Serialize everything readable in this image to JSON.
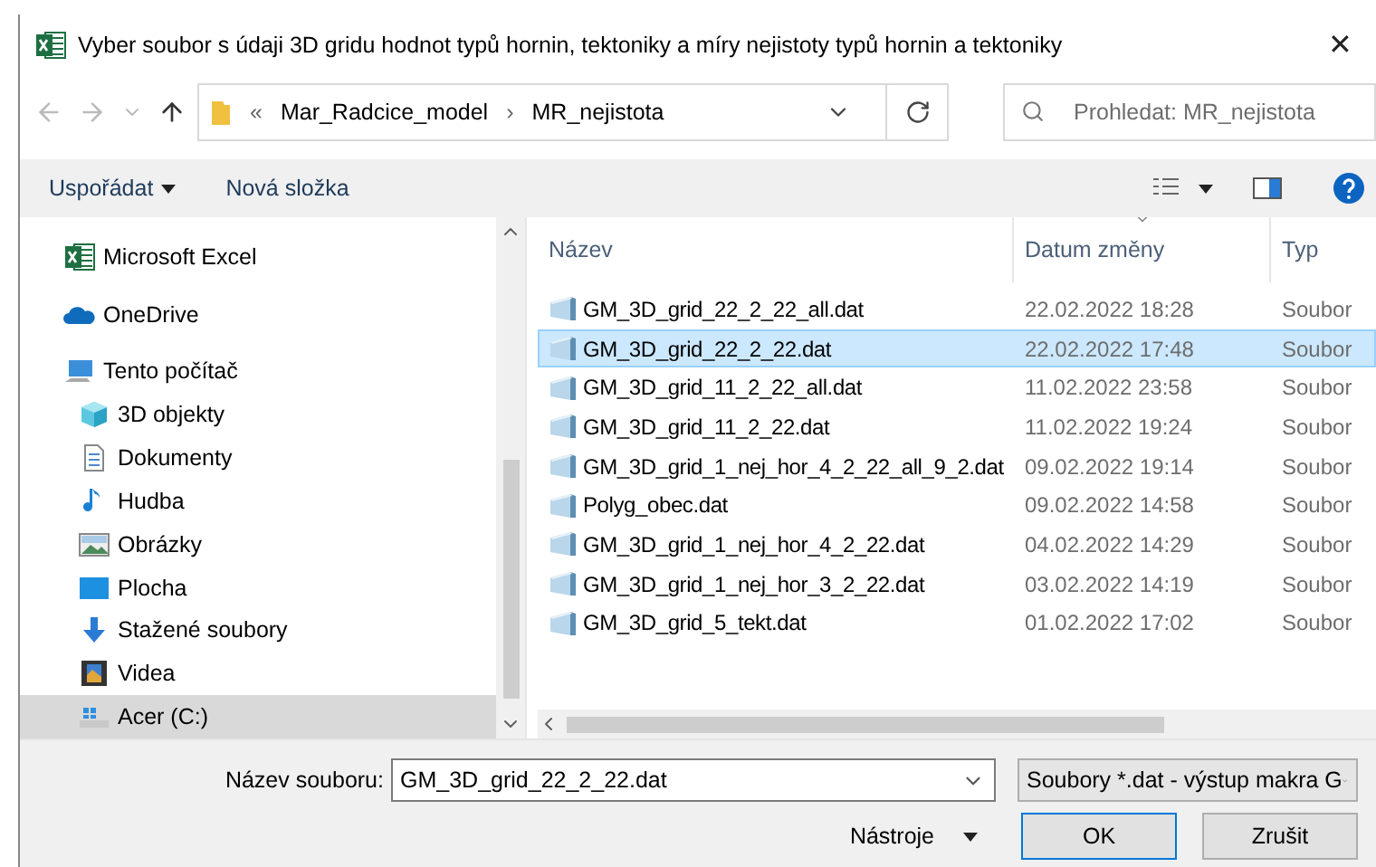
{
  "window": {
    "title": "Vyber soubor s údaji 3D gridu hodnot typů hornin, tektoniky a míry nejistoty typů hornin a tektoniky",
    "close": "✕"
  },
  "address": {
    "prefix": "«",
    "path": [
      "Mar_Radcice_model",
      "MR_nejistota"
    ],
    "separator": "›"
  },
  "search": {
    "placeholder": "Prohledat: MR_nejistota"
  },
  "toolbar": {
    "organize": "Uspořádat",
    "new_folder": "Nová složka"
  },
  "nav": [
    {
      "label": "Microsoft Excel",
      "kind": "excel",
      "selected": false
    },
    {
      "label": "OneDrive",
      "kind": "cloud",
      "selected": false
    },
    {
      "label": "Tento počítač",
      "kind": "computer",
      "selected": false,
      "children": [
        {
          "label": "3D objekty",
          "kind": "cube",
          "selected": false
        },
        {
          "label": "Dokumenty",
          "kind": "document",
          "selected": false
        },
        {
          "label": "Hudba",
          "kind": "music",
          "selected": false
        },
        {
          "label": "Obrázky",
          "kind": "pictures",
          "selected": false
        },
        {
          "label": "Plocha",
          "kind": "desktop",
          "selected": false
        },
        {
          "label": "Stažené soubory",
          "kind": "download",
          "selected": false
        },
        {
          "label": "Videa",
          "kind": "video",
          "selected": false
        },
        {
          "label": "Acer (C:)",
          "kind": "drive",
          "selected": true
        }
      ]
    }
  ],
  "table": {
    "columns": [
      "Název",
      "Datum změny",
      "Typ"
    ],
    "rows": [
      {
        "name": "GM_3D_grid_22_2_22_all.dat",
        "date": "22.02.2022 18:28",
        "type": "Soubor",
        "selected": false
      },
      {
        "name": "GM_3D_grid_22_2_22.dat",
        "date": "22.02.2022 17:48",
        "type": "Soubor",
        "selected": true
      },
      {
        "name": "GM_3D_grid_11_2_22_all.dat",
        "date": "11.02.2022 23:58",
        "type": "Soubor",
        "selected": false
      },
      {
        "name": "GM_3D_grid_11_2_22.dat",
        "date": "11.02.2022 19:24",
        "type": "Soubor",
        "selected": false
      },
      {
        "name": "GM_3D_grid_1_nej_hor_4_2_22_all_9_2.dat",
        "date": "09.02.2022 19:14",
        "type": "Soubor",
        "selected": false
      },
      {
        "name": "Polyg_obec.dat",
        "date": "09.02.2022 14:58",
        "type": "Soubor",
        "selected": false
      },
      {
        "name": "GM_3D_grid_1_nej_hor_4_2_22.dat",
        "date": "04.02.2022 14:29",
        "type": "Soubor",
        "selected": false
      },
      {
        "name": "GM_3D_grid_1_nej_hor_3_2_22.dat",
        "date": "03.02.2022 14:19",
        "type": "Soubor",
        "selected": false
      },
      {
        "name": "GM_3D_grid_5_tekt.dat",
        "date": "01.02.2022 17:02",
        "type": "Soubor",
        "selected": false
      }
    ]
  },
  "footer": {
    "filename_label": "Název souboru:",
    "filename": "GM_3D_grid_22_2_22.dat",
    "filter": "Soubory *.dat - výstup makra G",
    "tools": "Nástroje",
    "ok": "OK",
    "cancel": "Zrušit"
  }
}
